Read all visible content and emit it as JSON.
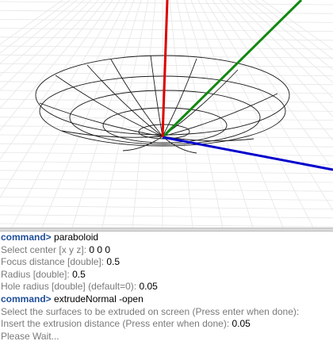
{
  "viewport": {
    "axis_colors": {
      "x": "#0000cc",
      "y": "#118811",
      "z": "#dd0000"
    },
    "grid_color": "#e6e6e6",
    "wire_color": "#1a1a1a"
  },
  "console": {
    "lines": [
      {
        "type": "command",
        "prompt": "command>",
        "text": "paraboloid"
      },
      {
        "type": "param",
        "label": "Select center [x y z]:",
        "value": "0 0 0"
      },
      {
        "type": "param",
        "label": "Focus distance [double]:",
        "value": "0.5"
      },
      {
        "type": "param",
        "label": "Radius [double]:",
        "value": "0.5"
      },
      {
        "type": "param",
        "label": "Hole radius [double] (default=0):",
        "value": "0.05"
      },
      {
        "type": "command",
        "prompt": "command>",
        "text": "extrudeNormal -open"
      },
      {
        "type": "param",
        "label": "Select the surfaces to be extruded on screen (Press enter when done):",
        "value": ""
      },
      {
        "type": "param",
        "label": "Insert the extrusion distance (Press enter when done):",
        "value": "0.05"
      },
      {
        "type": "status",
        "text": "Please Wait..."
      }
    ]
  }
}
